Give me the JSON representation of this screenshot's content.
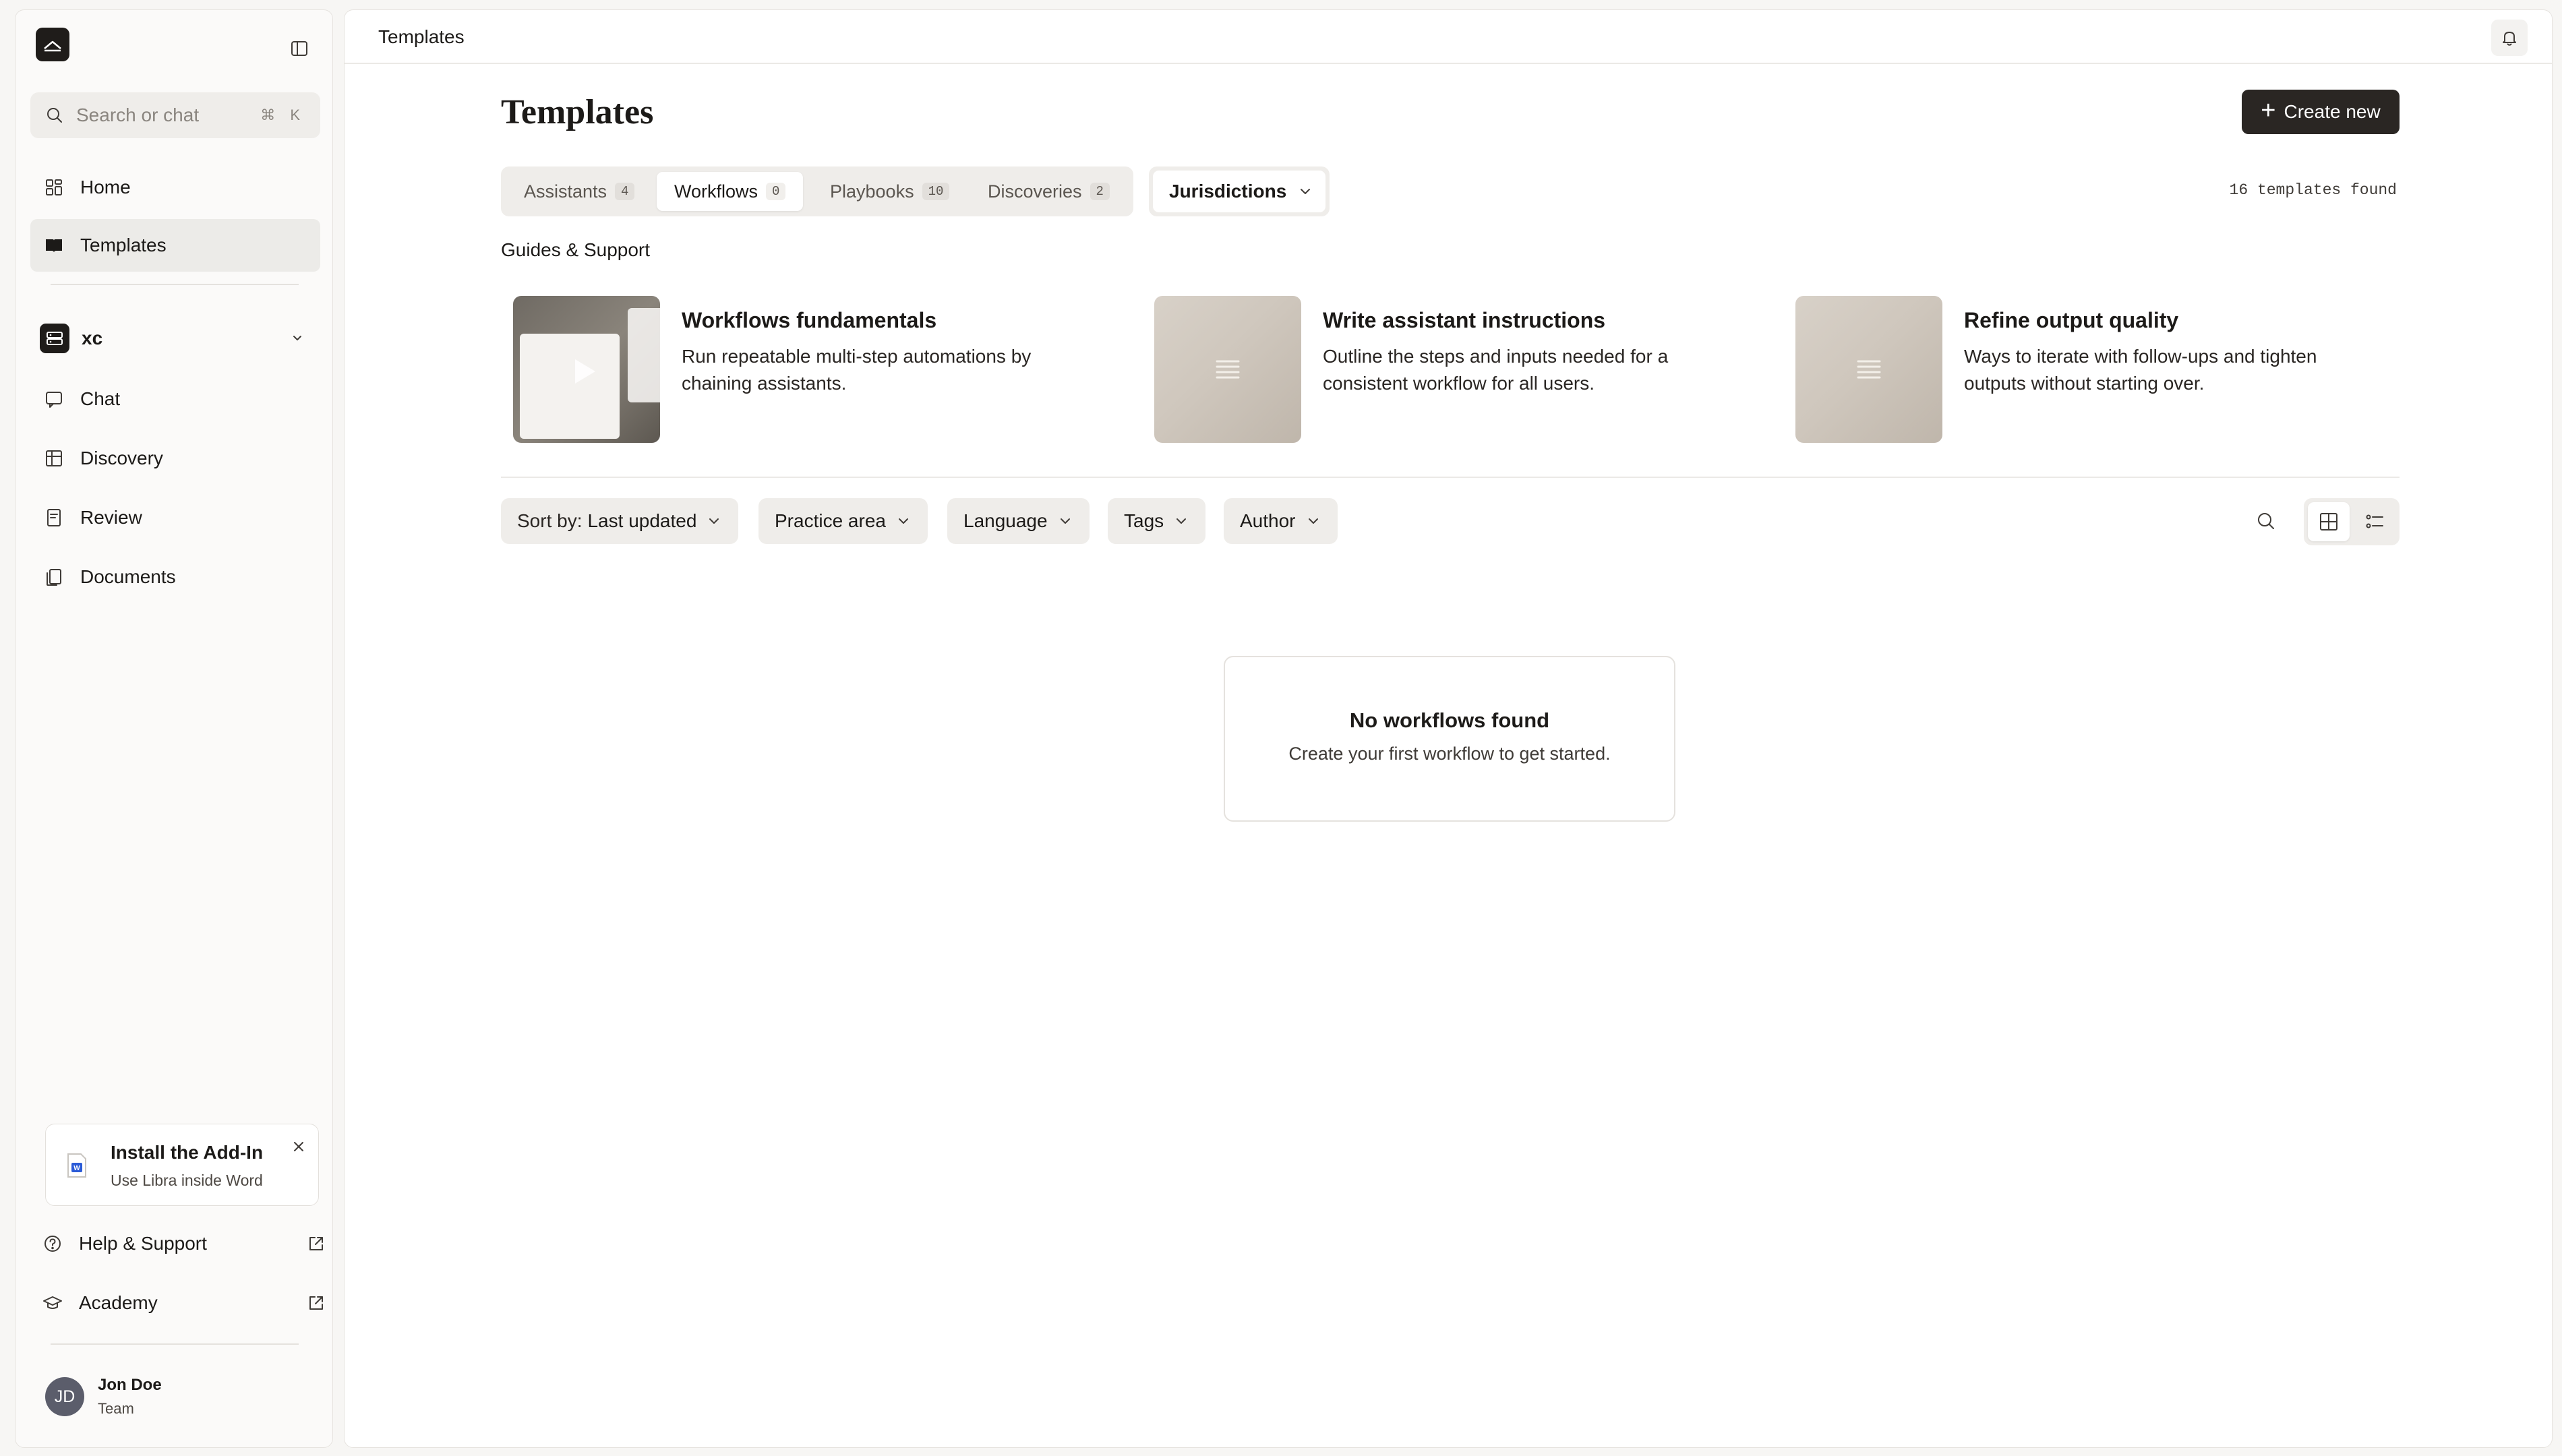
{
  "sidebar": {
    "search": {
      "placeholder": "Search or chat",
      "shortcut": "⌘ K"
    },
    "nav_top": [
      {
        "label": "Home",
        "icon": "home-grid-icon"
      },
      {
        "label": "Templates",
        "icon": "book-open-icon",
        "active": true
      }
    ],
    "workspace": {
      "name": "xc"
    },
    "nav_ws": [
      {
        "label": "Chat",
        "icon": "chat-icon"
      },
      {
        "label": "Discovery",
        "icon": "table-icon"
      },
      {
        "label": "Review",
        "icon": "review-icon"
      },
      {
        "label": "Documents",
        "icon": "documents-icon"
      }
    ],
    "addin": {
      "title": "Install the Add-In",
      "subtitle": "Use Libra inside Word"
    },
    "footer": [
      {
        "label": "Help & Support",
        "icon": "help-icon"
      },
      {
        "label": "Academy",
        "icon": "graduation-cap-icon"
      }
    ],
    "user": {
      "initials": "JD",
      "name": "Jon Doe",
      "role": "Team"
    }
  },
  "topbar": {
    "breadcrumb": "Templates"
  },
  "main": {
    "title": "Templates",
    "create_label": "Create new",
    "tabs": [
      {
        "label": "Assistants",
        "count": "4"
      },
      {
        "label": "Workflows",
        "count": "0",
        "active": true
      },
      {
        "label": "Playbooks",
        "count": "10"
      },
      {
        "label": "Discoveries",
        "count": "2"
      }
    ],
    "jurisdictions_label": "Jurisdictions",
    "found_text": "16 templates found",
    "guides_heading": "Guides & Support",
    "guides": [
      {
        "title": "Workflows fundamentals",
        "desc": "Run repeatable multi-step automations by chaining assistants."
      },
      {
        "title": "Write assistant instructions",
        "desc": "Outline the steps and inputs needed for a consistent workflow for all users."
      },
      {
        "title": "Refine output quality",
        "desc": "Ways to iterate with follow-ups and tighten outputs without starting over."
      }
    ],
    "filters": {
      "sort_prefix": "Sort by:",
      "sort_value": "Last updated",
      "practice_area": "Practice area",
      "language": "Language",
      "tags": "Tags",
      "author": "Author"
    },
    "empty": {
      "title": "No workflows found",
      "subtitle": "Create your first workflow to get started."
    }
  },
  "colors": {
    "accent_dark": "#2a2623",
    "background": "#f7f6f4",
    "chip": "#efedea"
  }
}
